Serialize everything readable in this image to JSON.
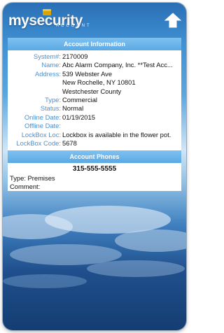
{
  "app": {
    "logo_my": "my",
    "logo_security": "security",
    "logo_sub": "ACCOUNT"
  },
  "account_info": {
    "title": "Account Information",
    "fields": [
      {
        "label": "System#:",
        "value": "2170009"
      },
      {
        "label": "Name:",
        "value": "Abc Alarm Company, Inc. **Test Acc..."
      },
      {
        "label": "Address:",
        "value": "539 Webster Ave"
      },
      {
        "label": "",
        "value": "New Rochelle, NY 10801"
      },
      {
        "label": "",
        "value": "Westchester County"
      },
      {
        "label": "Type:",
        "value": "Commercial"
      },
      {
        "label": "Status:",
        "value": "Normal"
      },
      {
        "label": "Online Date:",
        "value": "01/19/2015"
      },
      {
        "label": "Offline Date:",
        "value": ""
      },
      {
        "label": "LockBox Loc:",
        "value": "Lockbox is available in the flower pot."
      },
      {
        "label": "LockBox Code:",
        "value": "5678"
      }
    ]
  },
  "account_phones": {
    "title": "Account Phones",
    "phone": "315-555-5555",
    "type_line": "Type: Premises",
    "comment_line": "Comment:"
  },
  "colors": {
    "header_bar": "#5aa9e4",
    "label_blue": "#4f8fd0"
  },
  "icons": {
    "up": "arrow-up-icon",
    "badge": "security-badge-icon"
  }
}
